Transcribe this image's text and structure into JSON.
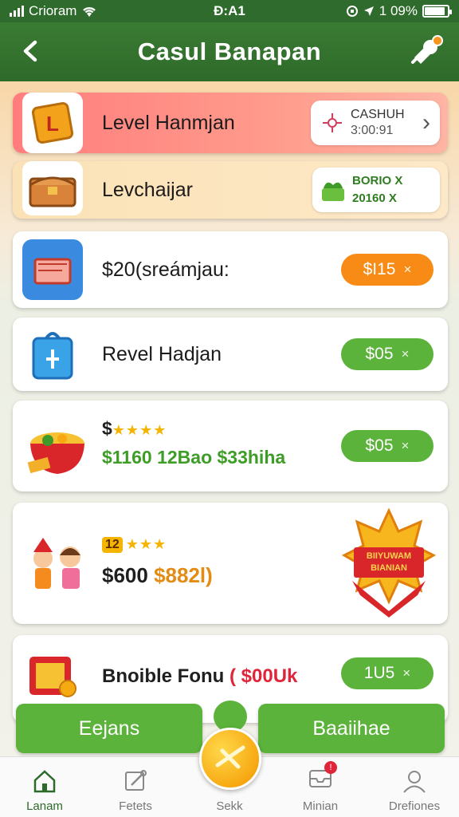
{
  "status": {
    "carrier": "Crioram",
    "time": "Đ:A1",
    "battery": "1 09%"
  },
  "header": {
    "title": "Casul Banapan",
    "back": "‹"
  },
  "cards": [
    {
      "label": "Level Hanmjan",
      "chip_line1": "CASHUH",
      "chip_line2": "3:00:91",
      "chevron": "›"
    },
    {
      "label": "Levchaijar",
      "mini_line1": "BORIO X",
      "mini_line2": "20160 X"
    },
    {
      "label": "$20(sreámjau:",
      "pill": "$I15",
      "x": "×"
    },
    {
      "label": "Revel Hadjan",
      "pill": "$05",
      "x": "×"
    },
    {
      "prefix": "$",
      "stars": "★★★★",
      "value_line": "$1160 12Bao $33hiha",
      "pill": "$05",
      "x": "×"
    },
    {
      "badge_count": "12",
      "stars": "★★★",
      "amount_black": "$600",
      "amount_orange": "$882l)",
      "badge_text_line1": "BIIYUWAM",
      "badge_text_line2": "BIANIAN"
    },
    {
      "label_black": "Bnoible Fonu",
      "label_red": "( $00Uk",
      "pill": "1U5",
      "x": "×"
    }
  ],
  "actions": {
    "left_button": "Eejans",
    "right_button": "Baaiihae"
  },
  "tabs": [
    {
      "label": "Lanam",
      "icon": "home-icon"
    },
    {
      "label": "Fetets",
      "icon": "edit-icon"
    },
    {
      "label": "Sekk",
      "icon": "coin-icon"
    },
    {
      "label": "Minian",
      "icon": "inbox-icon",
      "badge": "!"
    },
    {
      "label": "Drefiones",
      "icon": "user-icon"
    }
  ],
  "colors": {
    "header": "#2e6a2a",
    "green": "#5cb33c",
    "orange": "#f78b15",
    "red": "#e0243a"
  }
}
